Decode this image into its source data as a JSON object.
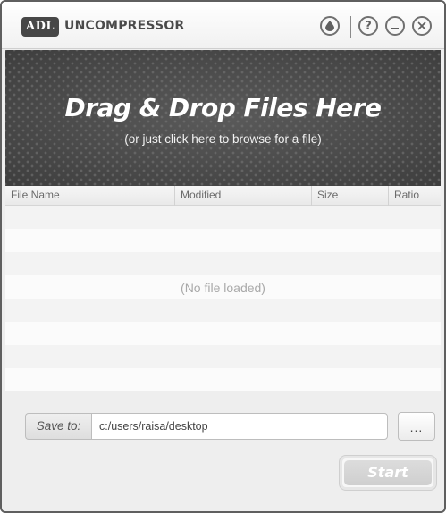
{
  "app": {
    "logo_text": "ADL",
    "title": "UNCOMPRESSOR"
  },
  "titlebar": {
    "theme_icon": "droplet-icon",
    "help_label": "?",
    "minimize_label": "—",
    "close_label": "✕"
  },
  "dropzone": {
    "title": "Drag & Drop Files Here",
    "subtitle": "(or just click here to browse for a file)"
  },
  "table": {
    "columns": [
      "File Name",
      "Modified",
      "Size",
      "Ratio"
    ],
    "rows": [],
    "empty_message": "(No file loaded)"
  },
  "save": {
    "label": "Save to:",
    "path": "c:/users/raisa/desktop",
    "browse_label": "..."
  },
  "actions": {
    "start_label": "Start"
  },
  "colors": {
    "dropzone_bg": "#4d4d4d",
    "title_text": "#4a4a4a",
    "start_disabled": "#d6d6d6"
  }
}
